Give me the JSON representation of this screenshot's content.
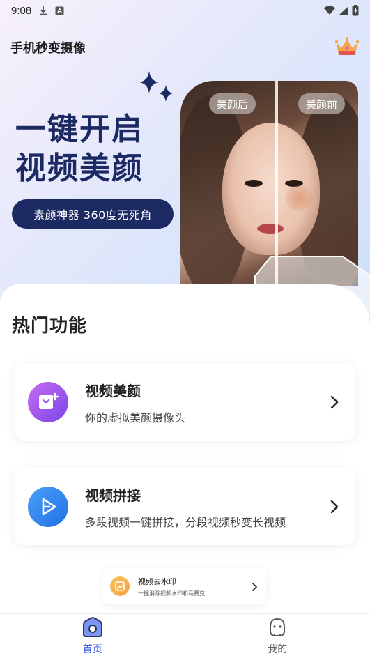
{
  "status_bar": {
    "time": "9:08"
  },
  "header": {
    "title": "手机秒变摄像"
  },
  "hero": {
    "headline_line1": "一键开启",
    "headline_line2": "视频美颜",
    "pill_text": "素颜神器 360度无死角",
    "tag_after": "美颜后",
    "tag_before": "美颜前"
  },
  "section": {
    "title": "热门功能"
  },
  "features": [
    {
      "title": "视频美颜",
      "subtitle": "你的虚拟美颜摄像头",
      "icon": "camera-plus-icon"
    },
    {
      "title": "视频拼接",
      "subtitle": "多段视频一键拼接，分段视频秒变长视频",
      "icon": "play-join-icon"
    }
  ],
  "mini_feature": {
    "title": "视频去水印",
    "subtitle": "一键消除视频水印和马赛克",
    "icon": "image-remove-icon"
  },
  "bottom_nav": [
    {
      "label": "首页",
      "icon": "home-icon",
      "active": true
    },
    {
      "label": "我的",
      "icon": "profile-icon",
      "active": false
    }
  ],
  "colors": {
    "accent": "#4460e0",
    "headline": "#1c2a63",
    "card_icon_1": "#9a5aee",
    "card_icon_2": "#3d8ef2"
  }
}
